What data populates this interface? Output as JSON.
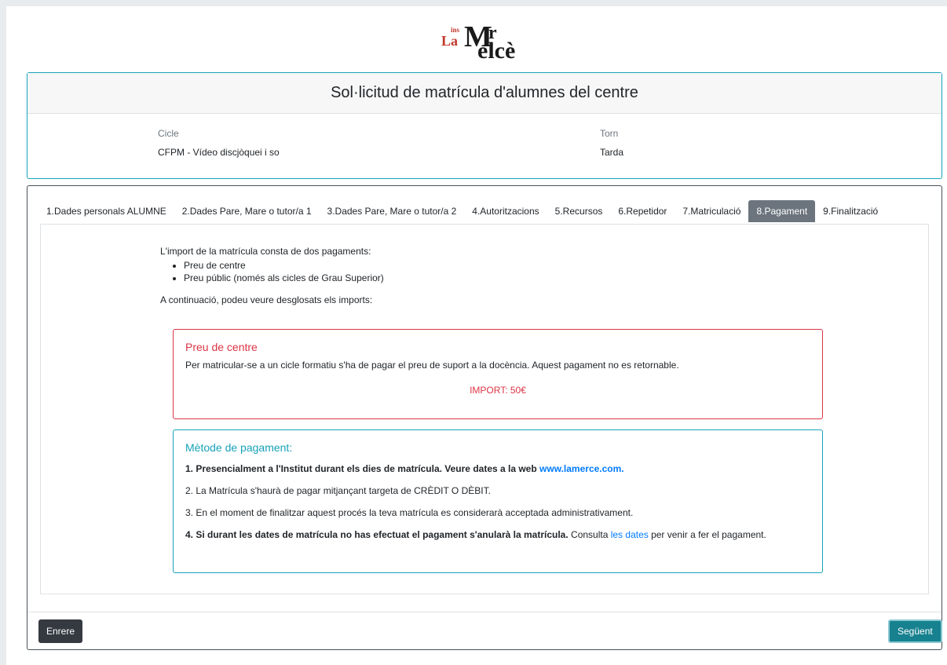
{
  "logo": {
    "ins": "ins",
    "la": "La",
    "m": "M",
    "r": "r",
    "elce": "elcè"
  },
  "header": {
    "title": "Sol·licitud de matrícula d'alumnes del centre",
    "cicle_label": "Cicle",
    "cicle_value": "CFPM - Vídeo discjòquei i so",
    "torn_label": "Torn",
    "torn_value": "Tarda"
  },
  "tabs": [
    {
      "label": "1.Dades personals ALUMNE"
    },
    {
      "label": "2.Dades Pare, Mare o tutor/a 1"
    },
    {
      "label": "3.Dades Pare, Mare o tutor/a 2"
    },
    {
      "label": "4.Autoritzacions"
    },
    {
      "label": "5.Recursos"
    },
    {
      "label": "6.Repetidor"
    },
    {
      "label": "7.Matriculació"
    },
    {
      "label": "8.Pagament"
    },
    {
      "label": "9.Finalització"
    }
  ],
  "active_tab": "8.Pagament",
  "intro": {
    "text": "L'import de la matrícula consta de dos pagaments:",
    "items": [
      "Preu de centre",
      "Preu públic (només als cicles de Grau Superior)"
    ],
    "cont": "A continuació, podeu veure desglosats els imports:"
  },
  "preu_centre": {
    "title": "Preu de centre",
    "body": "Per matricular-se a un cicle formatiu s'ha de pagar el preu de suport a la docència. Aquest pagament no es retornable.",
    "import": "IMPORT: 50€"
  },
  "metode": {
    "title": "Mètode de pagament:",
    "p1_bold": "1. Presencialment a l'Institut durant els dies de matrícula. Veure dates a la web ",
    "p1_link": "www.lamerce.com.",
    "p2": "2. La Matrícula s'haurà de pagar mitjançant targeta de CRÈDIT O DÈBIT.",
    "p3": "3. En el moment de finalitzar aquest procés la teva matrícula es considerarà acceptada administrativament.",
    "p4_bold": "4. Si durant les dates de matrícula no has efectuat el pagament s'anularà la matrícula.",
    "p4_a": " Consulta ",
    "p4_link": "les dates",
    "p4_b": " per venir a fer el pagament."
  },
  "buttons": {
    "back": "Enrere",
    "next": "Següent"
  },
  "colors": {
    "teal": "#17a2b8",
    "red": "#dc3545",
    "tab_active": "#6c757d",
    "btn_dark": "#343a40",
    "btn_next": "#17818f",
    "link": "#007bff"
  }
}
